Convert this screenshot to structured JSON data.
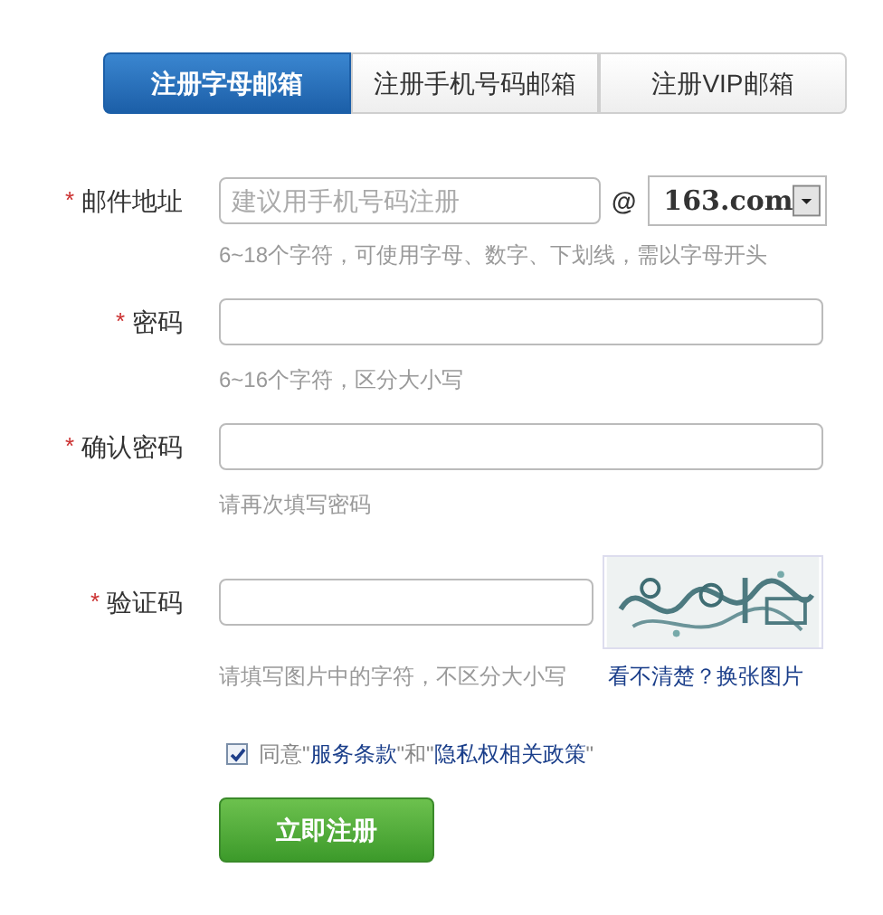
{
  "tabs": [
    {
      "label": "注册字母邮箱",
      "selected": true
    },
    {
      "label": "注册手机号码邮箱",
      "selected": false
    },
    {
      "label": "注册VIP邮箱",
      "selected": false
    }
  ],
  "fields": [
    {
      "kind": "email",
      "required_mark": "*",
      "label": "邮件地址",
      "placeholder": "建议用手机号码注册",
      "at": "@",
      "domain": "163.com",
      "hint": "6~18个字符，可使用字母、数字、下划线，需以字母开头"
    },
    {
      "kind": "password",
      "required_mark": "*",
      "label": "密码",
      "hint": "6~16个字符，区分大小写"
    },
    {
      "kind": "password",
      "required_mark": "*",
      "label": "确认密码",
      "hint": "请再次填写密码"
    },
    {
      "kind": "captcha",
      "required_mark": "*",
      "label": "验证码",
      "hint": "请填写图片中的字符，不区分大小写",
      "link": "看不清楚？换张图片"
    }
  ],
  "agreement": {
    "checked": true,
    "parts": [
      {
        "kind": "text",
        "text": "同意\""
      },
      {
        "kind": "link",
        "text": "服务条款"
      },
      {
        "kind": "text",
        "text": "\"和\""
      },
      {
        "kind": "link",
        "text": "隐私权相关政策"
      },
      {
        "kind": "text",
        "text": "\""
      }
    ]
  },
  "submit": "立即注册"
}
